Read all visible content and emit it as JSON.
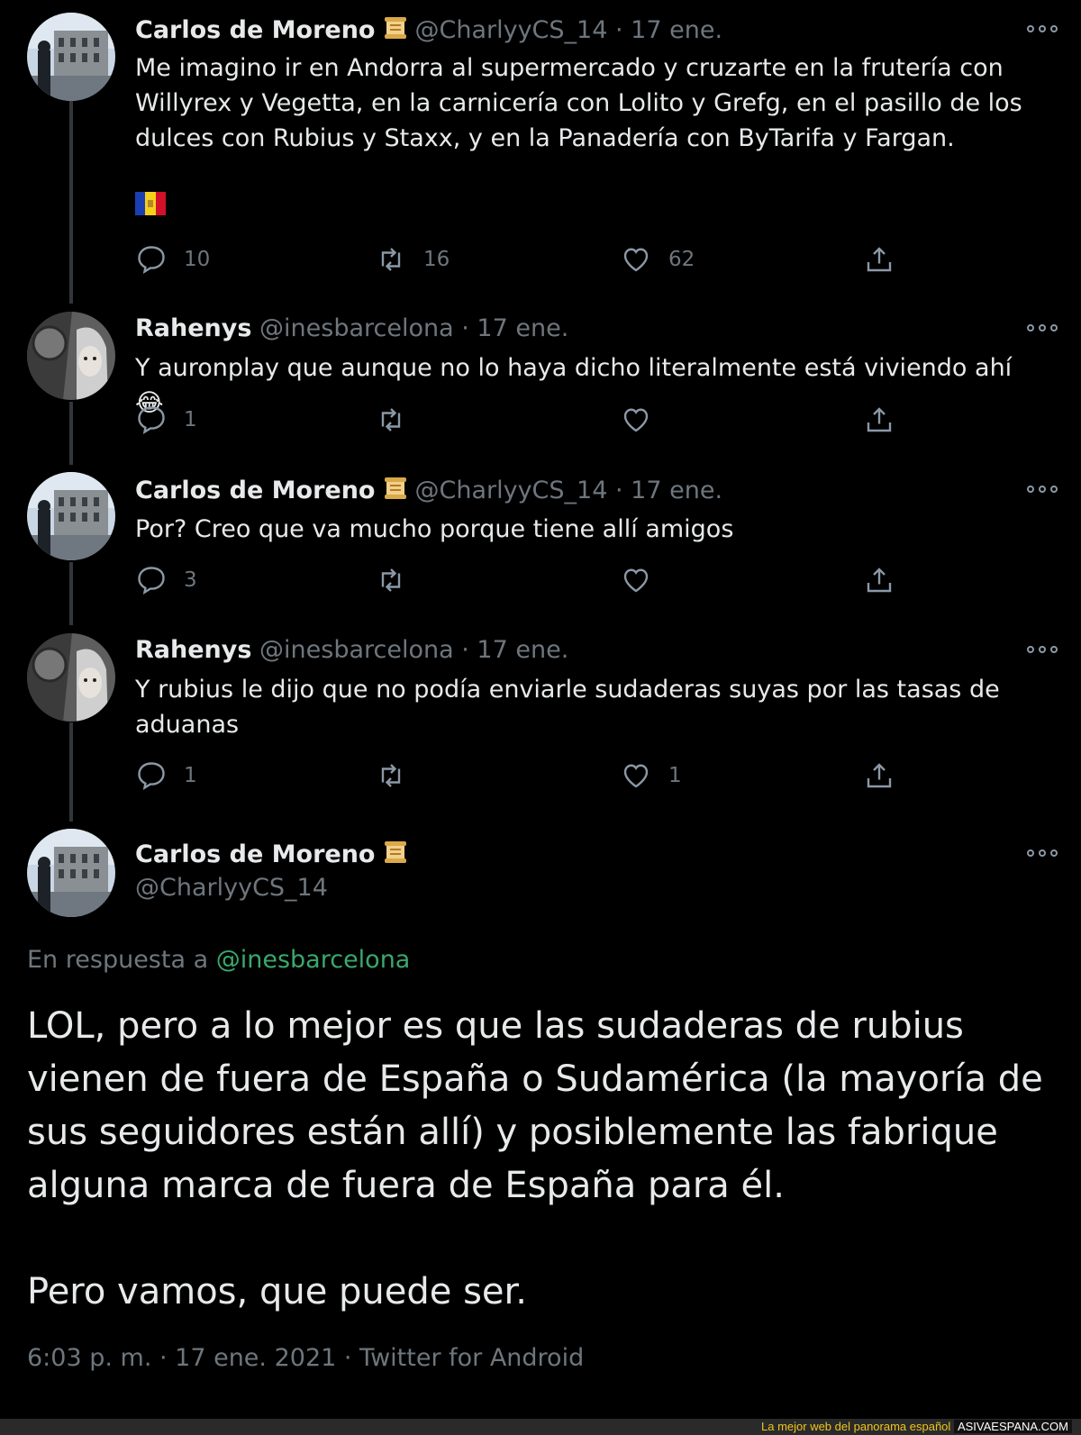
{
  "tweets": [
    {
      "name": "Carlos de Moreno",
      "handle": "@CharlyyCS_14",
      "date": "· 17 ene.",
      "text": "Me imagino ir en Andorra al supermercado y cruzarte en la frutería con Willyrex y Vegetta, en la carnicería con Lolito y Grefg, en el pasillo de los dulces con Rubius y Staxx, y en la Panadería con ByTarifa y Fargan.",
      "replies": "10",
      "retweets": "16",
      "likes": "62"
    },
    {
      "name": "Rahenys",
      "handle": "@inesbarcelona",
      "date": "· 17 ene.",
      "text": "Y auronplay que aunque no lo haya dicho literalmente está viviendo ahí 😂",
      "replies": "1",
      "retweets": "",
      "likes": ""
    },
    {
      "name": "Carlos de Moreno",
      "handle": "@CharlyyCS_14",
      "date": "· 17 ene.",
      "text": "Por? Creo que va mucho porque tiene allí amigos",
      "replies": "3",
      "retweets": "",
      "likes": ""
    },
    {
      "name": "Rahenys",
      "handle": "@inesbarcelona",
      "date": "· 17 ene.",
      "text": "Y rubius le dijo que no podía enviarle sudaderas suyas por las tasas de aduanas",
      "replies": "1",
      "retweets": "",
      "likes": "1"
    }
  ],
  "main_tweet": {
    "name": "Carlos de Moreno",
    "handle": "@CharlyyCS_14",
    "reply_prefix": "En respuesta a",
    "reply_to": "@inesbarcelona",
    "paragraph1": "LOL, pero a lo mejor es que las sudaderas de rubius vienen de fuera de España o Sudamérica (la mayoría de sus seguidores están allí) y posiblemente las fabrique alguna marca de fuera de España para él.",
    "paragraph2": "Pero vamos, que puede ser.",
    "timestamp": "6:03 p. m. · 17 ene. 2021 · Twitter for Android"
  },
  "footer": {
    "tagline": "La mejor web del panorama español",
    "site": "ASIVAESPANA.COM"
  },
  "icons": {
    "reply": "reply-icon",
    "retweet": "retweet-icon",
    "like": "heart-icon",
    "share": "share-icon",
    "more": "more-options-icon",
    "badge": "scroll-emoji-icon",
    "flag": "andorra-flag-icon"
  },
  "colors": {
    "background": "#000000",
    "muted": "#6e767d",
    "text": "#e7e9ea",
    "link": "#3aa86b",
    "thread_line": "#333639"
  }
}
